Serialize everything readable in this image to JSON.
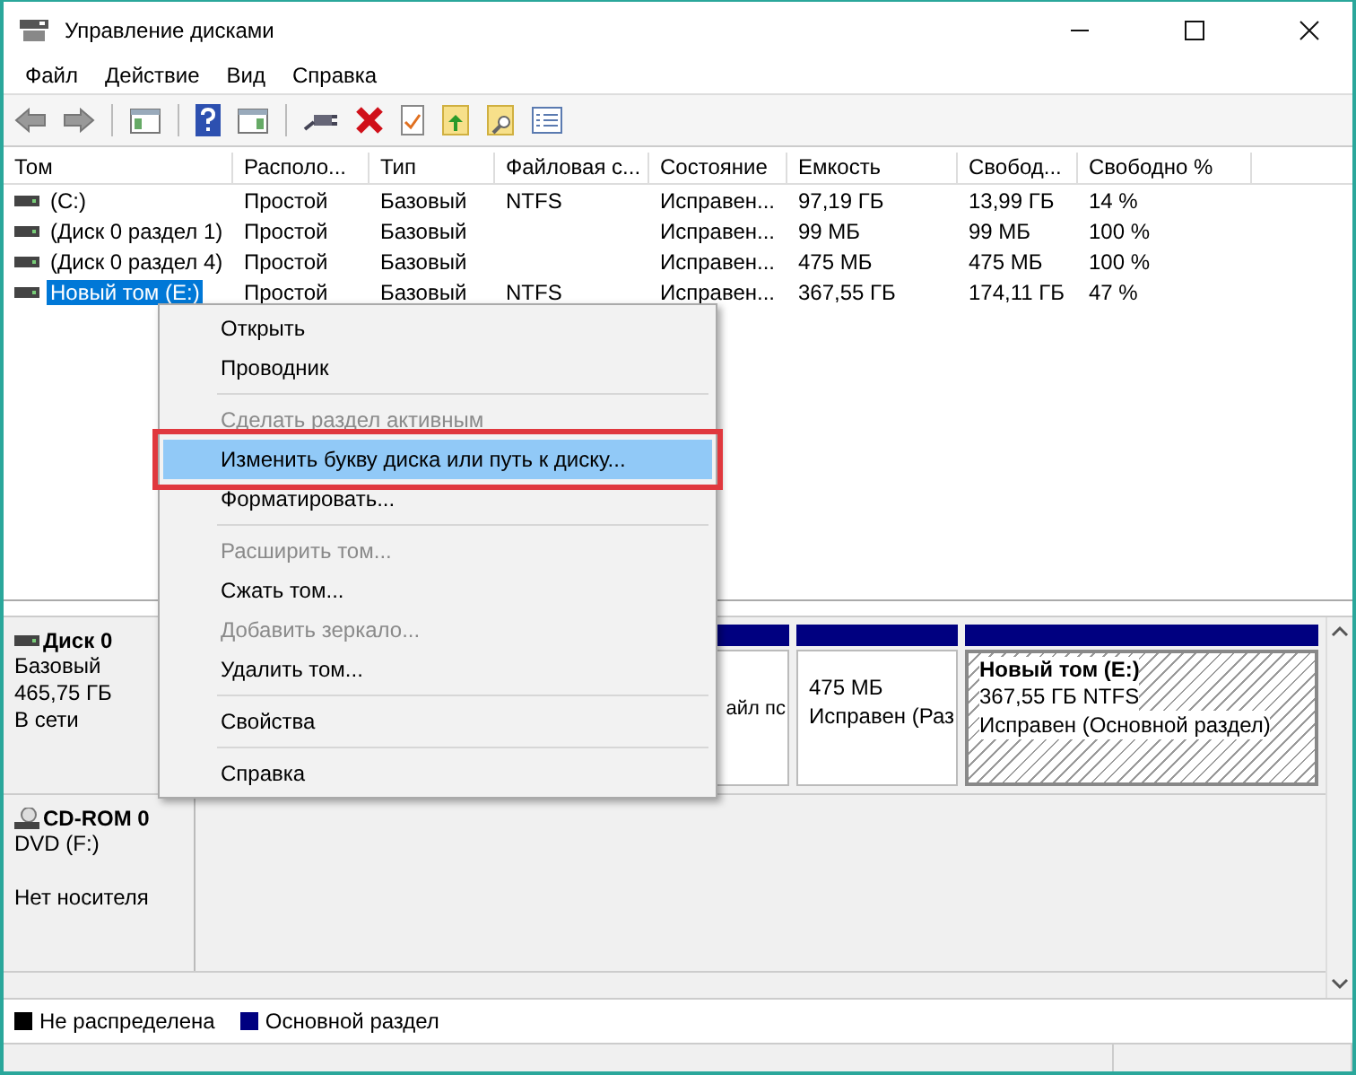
{
  "window": {
    "title": "Управление дисками"
  },
  "menu": [
    "Файл",
    "Действие",
    "Вид",
    "Справка"
  ],
  "table": {
    "columns": [
      "Том",
      "Располо...",
      "Тип",
      "Файловая с...",
      "Состояние",
      "Емкость",
      "Свобод...",
      "Свободно %"
    ],
    "rows": [
      {
        "selected": false,
        "cells": [
          "(C:)",
          "Простой",
          "Базовый",
          "NTFS",
          "Исправен...",
          "97,19 ГБ",
          "13,99 ГБ",
          "14 %"
        ]
      },
      {
        "selected": false,
        "cells": [
          "(Диск 0 раздел 1)",
          "Простой",
          "Базовый",
          "",
          "Исправен...",
          "99 МБ",
          "99 МБ",
          "100 %"
        ]
      },
      {
        "selected": false,
        "cells": [
          "(Диск 0 раздел 4)",
          "Простой",
          "Базовый",
          "",
          "Исправен...",
          "475 МБ",
          "475 МБ",
          "100 %"
        ]
      },
      {
        "selected": true,
        "cells": [
          "Новый том (E:)",
          "Простой",
          "Базовый",
          "NTFS",
          "Исправен...",
          "367,55 ГБ",
          "174,11 ГБ",
          "47 %"
        ]
      }
    ]
  },
  "context_menu": [
    {
      "kind": "item",
      "label": "Открыть",
      "disabled": false,
      "selected": false
    },
    {
      "kind": "item",
      "label": "Проводник",
      "disabled": false,
      "selected": false
    },
    {
      "kind": "separator"
    },
    {
      "kind": "item",
      "label": "Сделать раздел активным",
      "disabled": true,
      "selected": false
    },
    {
      "kind": "item",
      "label": "Изменить букву диска или путь к диску...",
      "disabled": false,
      "selected": true
    },
    {
      "kind": "item",
      "label": "Форматировать...",
      "disabled": false,
      "selected": false
    },
    {
      "kind": "separator"
    },
    {
      "kind": "item",
      "label": "Расширить том...",
      "disabled": true,
      "selected": false
    },
    {
      "kind": "item",
      "label": "Сжать том...",
      "disabled": false,
      "selected": false
    },
    {
      "kind": "item",
      "label": "Добавить зеркало...",
      "disabled": true,
      "selected": false
    },
    {
      "kind": "item",
      "label": "Удалить том...",
      "disabled": false,
      "selected": false
    },
    {
      "kind": "separator"
    },
    {
      "kind": "item",
      "label": "Свойства",
      "disabled": false,
      "selected": false
    },
    {
      "kind": "separator"
    },
    {
      "kind": "item",
      "label": "Справка",
      "disabled": false,
      "selected": false
    }
  ],
  "disks": [
    {
      "kind": "disk",
      "name": "Диск 0",
      "lines": [
        "Базовый",
        "465,75 ГБ",
        "В сети"
      ],
      "partitions": [
        {
          "selected": false,
          "lines": [
            "айл пс"
          ]
        },
        {
          "selected": false,
          "lines": [
            "475 МБ",
            "Исправен (Раз"
          ]
        },
        {
          "selected": true,
          "name": "Новый том  (E:)",
          "lines": [
            "367,55 ГБ NTFS",
            "Исправен (Основной раздел)"
          ]
        }
      ]
    },
    {
      "kind": "cdrom",
      "name": "CD-ROM 0",
      "lines": [
        "DVD (F:)"
      ],
      "status": "Нет носителя"
    }
  ],
  "legend": [
    {
      "label": "Не распределена",
      "color": "#000000"
    },
    {
      "label": "Основной раздел",
      "color": "#000080"
    }
  ]
}
